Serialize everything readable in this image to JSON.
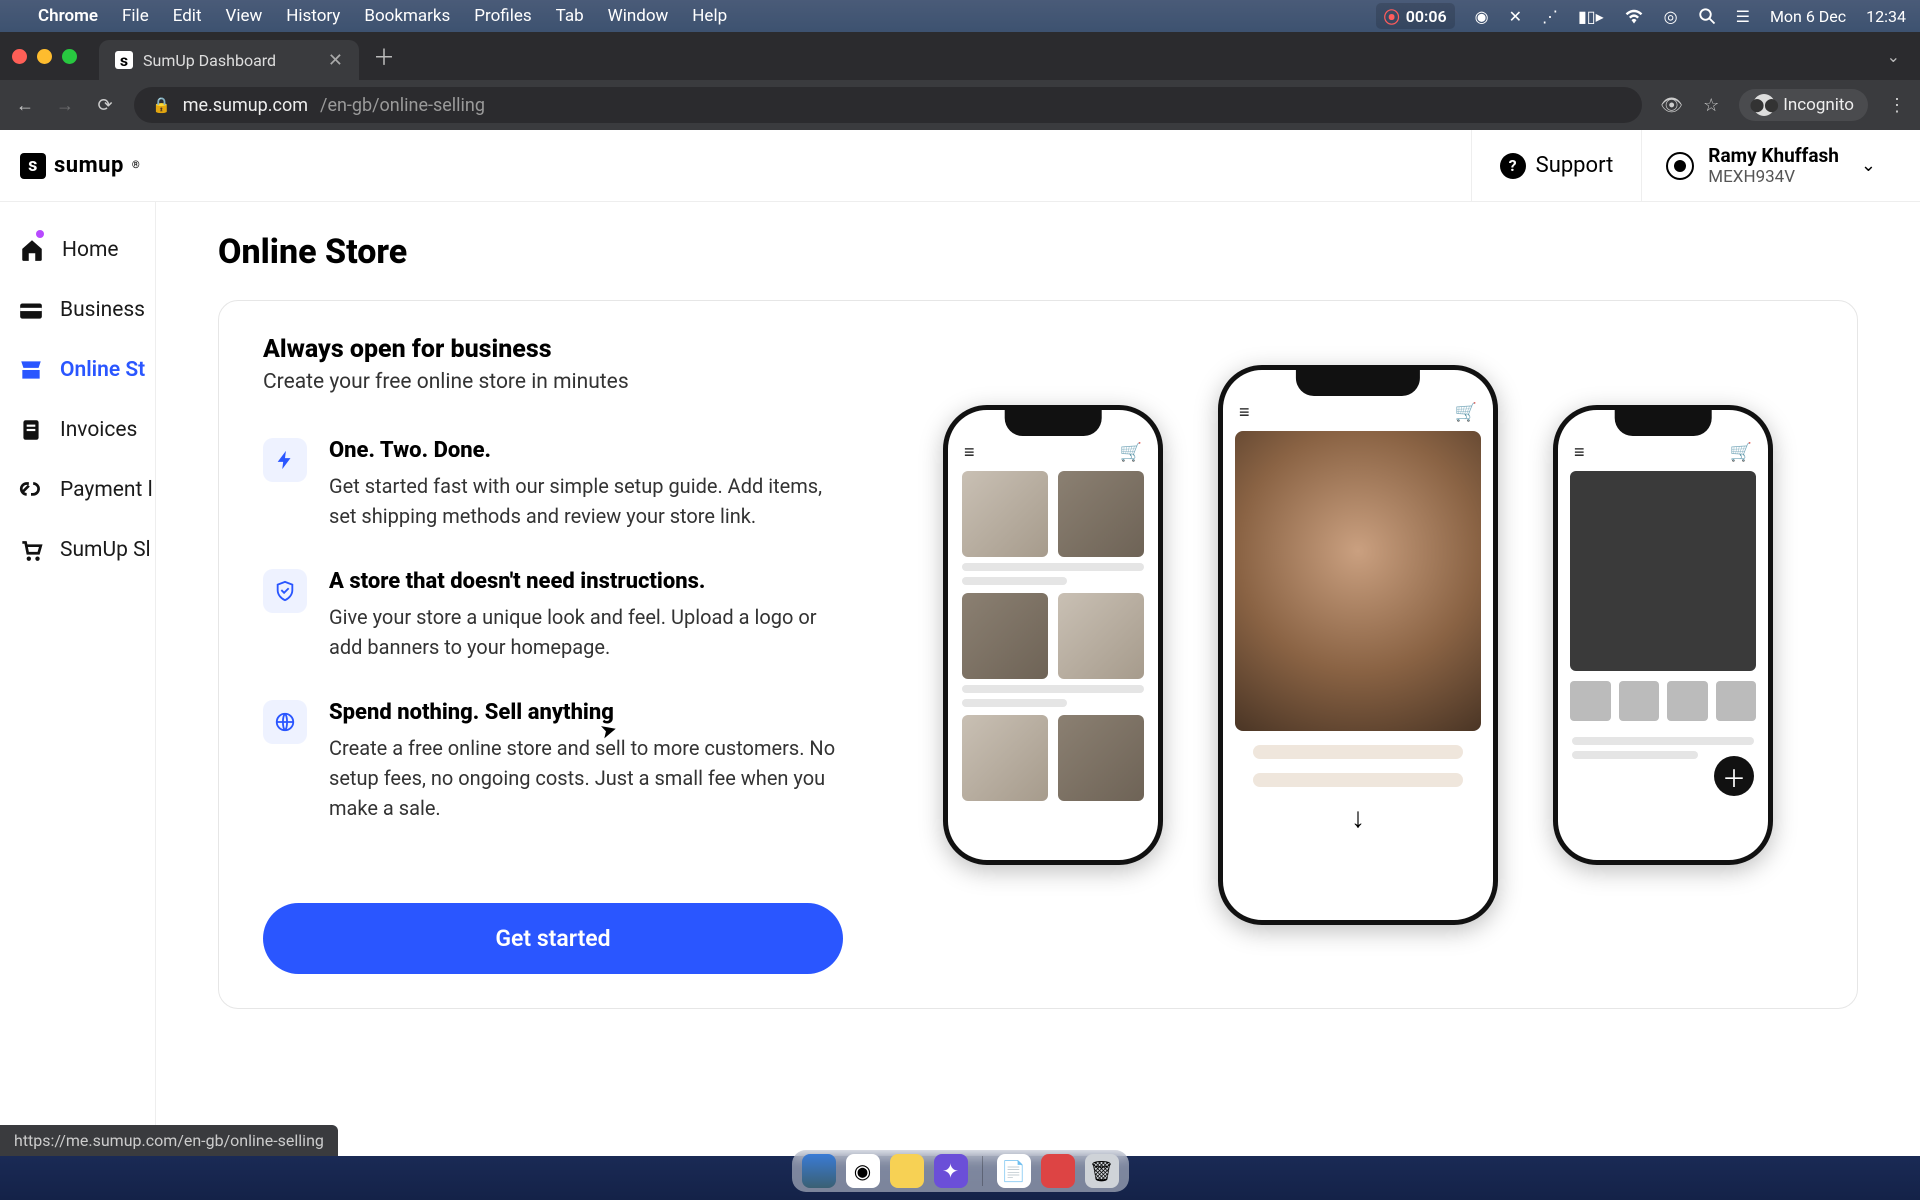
{
  "menubar": {
    "app": "Chrome",
    "items": [
      "File",
      "Edit",
      "View",
      "History",
      "Bookmarks",
      "Profiles",
      "Tab",
      "Window",
      "Help"
    ],
    "rec_time": "00:06",
    "date": "Mon 6 Dec",
    "time": "12:34"
  },
  "browser": {
    "tab_title": "SumUp Dashboard",
    "url_host": "me.sumup.com",
    "url_path": "/en-gb/online-selling",
    "incognito": "Incognito",
    "status_link": "https://me.sumup.com/en-gb/online-selling"
  },
  "header": {
    "logo": "sumup",
    "support": "Support",
    "user_name": "Ramy Khuffash",
    "user_code": "MEXH934V"
  },
  "sidebar": {
    "items": [
      {
        "label": "Home",
        "icon": "home"
      },
      {
        "label": "Business",
        "icon": "wallet"
      },
      {
        "label": "Online St",
        "icon": "store",
        "active": true
      },
      {
        "label": "Invoices",
        "icon": "invoice"
      },
      {
        "label": "Payment l",
        "icon": "link"
      },
      {
        "label": "SumUp Sl",
        "icon": "cart"
      }
    ]
  },
  "page": {
    "title": "Online Store",
    "card": {
      "heading": "Always open for business",
      "sub": "Create your free online store in minutes",
      "features": [
        {
          "icon": "bolt",
          "title": "One. Two. Done.",
          "desc": "Get started fast with our simple setup guide. Add items, set shipping methods and review your store link."
        },
        {
          "icon": "shield",
          "title": "A store that doesn't need instructions.",
          "desc": "Give your store a unique look and feel. Upload a logo or add banners to your homepage."
        },
        {
          "icon": "globe",
          "title": "Spend nothing. Sell anything",
          "desc": "Create a free online store and sell to more customers. No setup fees, no ongoing costs. Just a small fee when you make a sale."
        }
      ],
      "cta": "Get started"
    }
  }
}
